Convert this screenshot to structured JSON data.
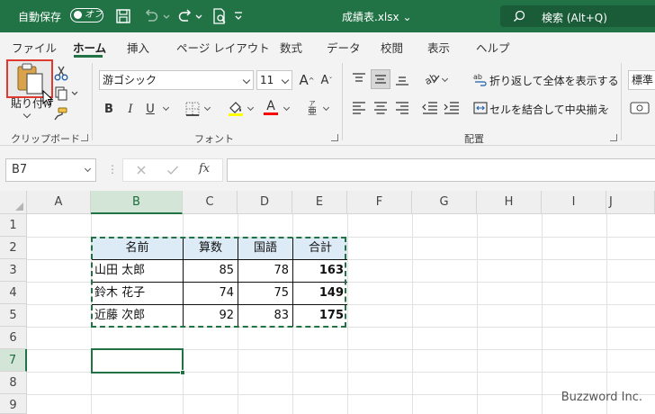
{
  "titlebar": {
    "autosave_label": "自動保存",
    "autosave_state": "オフ",
    "filename": "成績表.xlsx",
    "search_placeholder": "検索 (Alt+Q)",
    "accent_color": "#217346"
  },
  "menu": {
    "tabs": [
      "ファイル",
      "ホーム",
      "挿入",
      "ページ レイアウト",
      "数式",
      "データ",
      "校閲",
      "表示",
      "ヘルプ"
    ],
    "active_tab": "ホーム"
  },
  "ribbon": {
    "clipboard": {
      "paste_label": "貼り付け",
      "group_label": "クリップボード",
      "icons": [
        "paste-icon",
        "cut-icon",
        "copy-icon",
        "format-painter-icon"
      ]
    },
    "font": {
      "group_label": "フォント",
      "font_name": "游ゴシック",
      "font_size": "11",
      "grow_label": "A",
      "shrink_label": "A",
      "bold_label": "B",
      "italic_label": "I",
      "underline_label": "U",
      "font_color_label": "A",
      "phonetic_label": "亜",
      "highlight_color": "#ffff00",
      "font_color": "#ff0000"
    },
    "alignment": {
      "group_label": "配置",
      "wrap_text_label": "折り返して全体を表示する",
      "merge_center_label": "セルを結合して中央揃え"
    },
    "number": {
      "format_value": "標準"
    }
  },
  "formula_bar": {
    "name_box": "B7",
    "fx_label": "fx",
    "formula_value": ""
  },
  "grid": {
    "columns": [
      "A",
      "B",
      "C",
      "D",
      "E",
      "F",
      "G",
      "H",
      "I",
      "J"
    ],
    "rows": [
      "1",
      "2",
      "3",
      "4",
      "5",
      "6",
      "7",
      "8",
      "9"
    ],
    "selected_column": "B",
    "selected_row": "7"
  },
  "table": {
    "headers": [
      "名前",
      "算数",
      "国語",
      "合計"
    ],
    "rows": [
      {
        "name": "山田 太郎",
        "math": "85",
        "japanese": "78",
        "total": "163"
      },
      {
        "name": "鈴木 花子",
        "math": "74",
        "japanese": "75",
        "total": "149"
      },
      {
        "name": "近藤 次郎",
        "math": "92",
        "japanese": "83",
        "total": "175"
      }
    ],
    "header_fill": "#ddebf7"
  },
  "watermark": "Buzzword Inc."
}
